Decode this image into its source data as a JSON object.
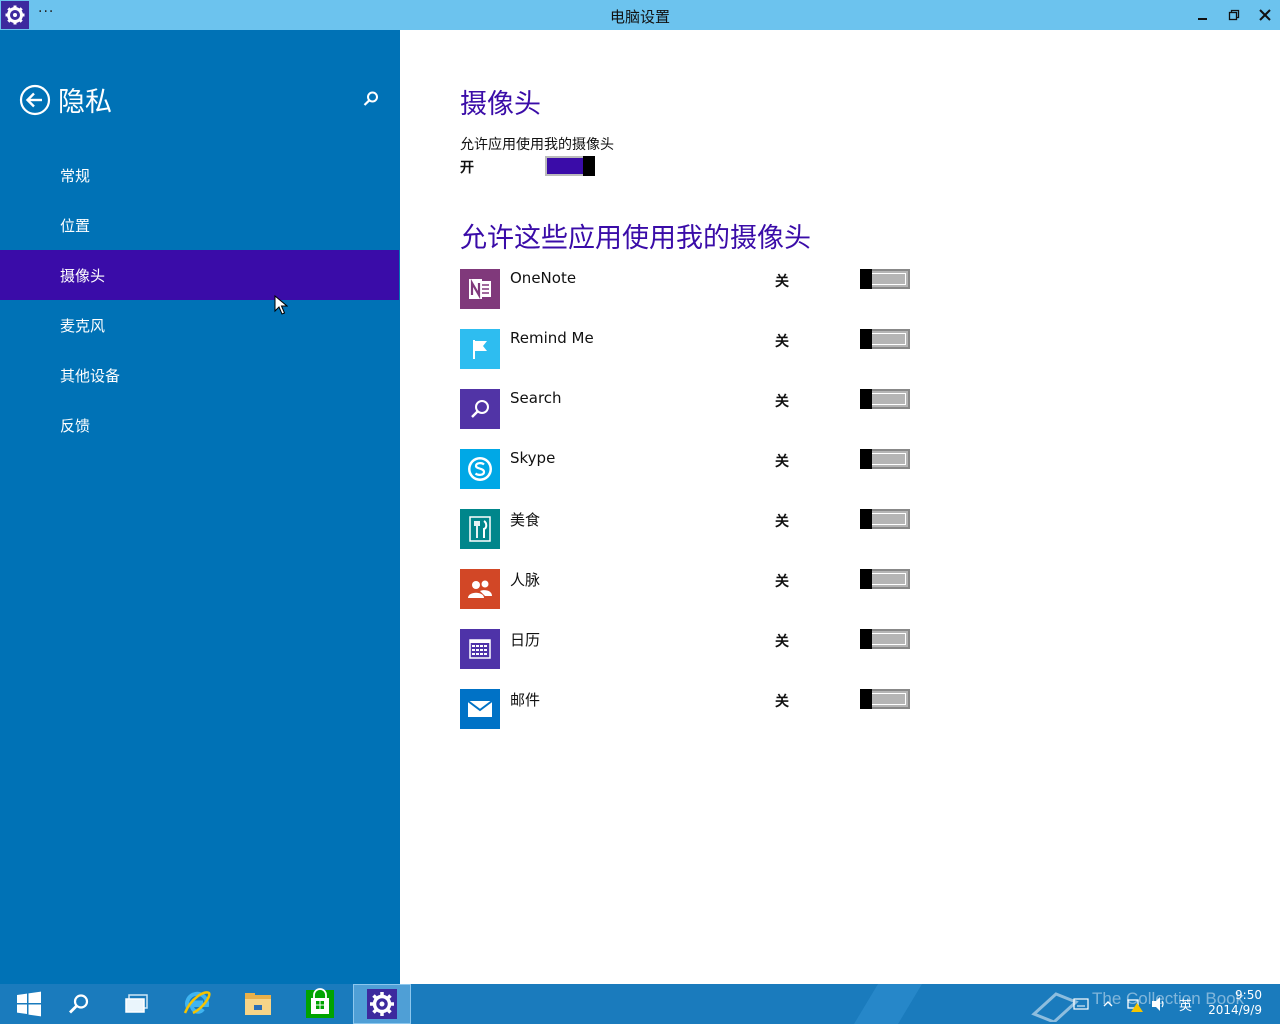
{
  "window": {
    "title": "电脑设置",
    "menu_glyph": "···"
  },
  "sidebar": {
    "title": "隐私",
    "items": [
      {
        "label": "常规"
      },
      {
        "label": "位置"
      },
      {
        "label": "摄像头",
        "selected": true
      },
      {
        "label": "麦克风"
      },
      {
        "label": "其他设备"
      },
      {
        "label": "反馈"
      }
    ]
  },
  "main": {
    "heading": "摄像头",
    "master": {
      "label": "允许应用使用我的摄像头",
      "state": "开",
      "on": true
    },
    "apps_heading": "允许这些应用使用我的摄像头",
    "apps": [
      {
        "name": "OneNote",
        "state": "关",
        "icon": "onenote-icon",
        "color": "#80397b"
      },
      {
        "name": "Remind Me",
        "state": "关",
        "icon": "flag-icon",
        "color": "#2ebdf0"
      },
      {
        "name": "Search",
        "state": "关",
        "icon": "search-icon",
        "color": "#5134a6"
      },
      {
        "name": "Skype",
        "state": "关",
        "icon": "skype-icon",
        "color": "#00a8e6"
      },
      {
        "name": "美食",
        "state": "关",
        "icon": "fork-knife-icon",
        "color": "#00868b"
      },
      {
        "name": "人脉",
        "state": "关",
        "icon": "people-icon",
        "color": "#d24726"
      },
      {
        "name": "日历",
        "state": "关",
        "icon": "calendar-icon",
        "color": "#4e33a8"
      },
      {
        "name": "邮件",
        "state": "关",
        "icon": "mail-icon",
        "color": "#0072c6"
      }
    ]
  },
  "taskbar": {
    "watermark": "The Collection Book",
    "tray_lang": "英",
    "time": "9:50",
    "date": "2014/9/9"
  },
  "colors": {
    "accent": "#3a0ca8",
    "sidebar": "#0072b6",
    "titlebar": "#6cc3ee",
    "taskbar": "#1a7bbd"
  }
}
